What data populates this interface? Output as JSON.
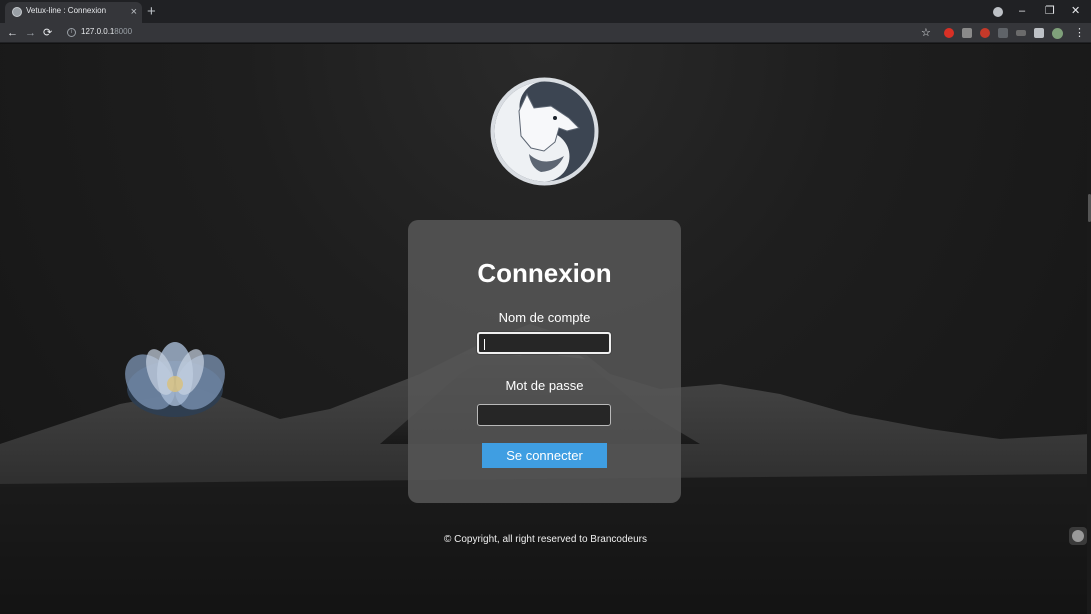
{
  "browser": {
    "tab_title": "Vetux-line : Connexion",
    "tab_close": "×",
    "new_tab": "+",
    "address_host": "127.0.0.1",
    "address_port": ":8000",
    "back": "←",
    "forward": "→",
    "reload": "⟳",
    "star": "☆",
    "menu": "⋮",
    "minimize": "–",
    "restore": "❐",
    "close": "✕"
  },
  "login": {
    "title": "Connexion",
    "username_label": "Nom de compte",
    "username_value": "",
    "password_label": "Mot de passe",
    "password_value": "",
    "submit_label": "Se connecter"
  },
  "footer": {
    "text": "© Copyright, all right reserved to Brancodeurs"
  },
  "colors": {
    "accent": "#3f9ee2",
    "card": "#555555",
    "background": "#1e1e1e"
  }
}
